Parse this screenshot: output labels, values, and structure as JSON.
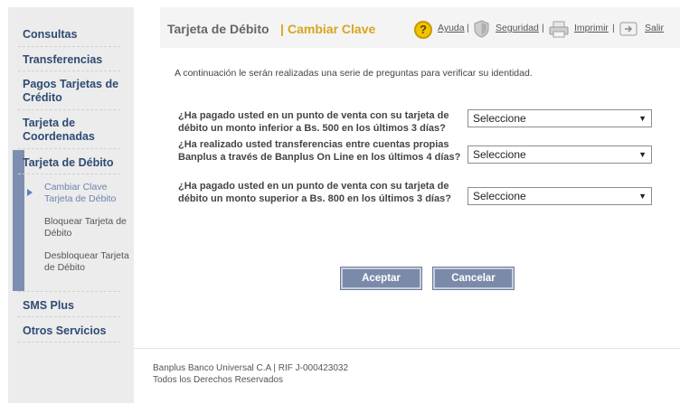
{
  "sidebar": {
    "items": [
      {
        "label": "Consultas"
      },
      {
        "label": "Transferencias"
      },
      {
        "label": "Pagos Tarjetas de Crédito"
      },
      {
        "label": "Tarjeta de Coordenadas"
      },
      {
        "label": "Tarjeta de Débito"
      },
      {
        "label": "SMS Plus"
      },
      {
        "label": "Otros Servicios"
      }
    ],
    "subitems": [
      {
        "label": "Cambiar Clave Tarjeta de Débito"
      },
      {
        "label": "Bloquear Tarjeta de Débito"
      },
      {
        "label": "Desbloquear Tarjeta de Débito"
      }
    ]
  },
  "header": {
    "title": "Tarjeta de Débito",
    "separator": "|",
    "subtitle": "Cambiar Clave",
    "help_glyph": "?",
    "links": {
      "ayuda": "Ayuda",
      "seguridad": "Seguridad",
      "imprimir": "Imprimir",
      "salir": "Salir",
      "pipe": "|"
    }
  },
  "form": {
    "intro": "A continuación le serán realizadas una serie de preguntas para verificar su identidad.",
    "questions": [
      {
        "text": "¿Ha pagado usted en un punto de venta con su tarjeta de débito un monto inferior a Bs. 500 en los últimos 3 días?",
        "selected": "Seleccione"
      },
      {
        "text": "¿Ha realizado usted transferencias entre cuentas propias Banplus a través de Banplus On Line en los últimos 4 días?",
        "selected": "Seleccione"
      },
      {
        "text": "¿Ha pagado usted en un punto de venta con su tarjeta de débito un monto superior a Bs. 800 en los últimos 3 días?",
        "selected": "Seleccione"
      }
    ],
    "accept_label": "Aceptar",
    "cancel_label": "Cancelar"
  },
  "footer": {
    "line1": "Banplus Banco Universal C.A | RIF J-000423032",
    "line2": "Todos los Derechos Reservados"
  },
  "icons": {
    "help": "help-icon",
    "security": "shield-icon",
    "print": "printer-icon",
    "exit": "exit-icon"
  },
  "colors": {
    "nav_text": "#2f4b73",
    "accent_gold": "#d7a51f",
    "button_bg": "#7b8aa9",
    "sidebar_accent": "#7c8fb0"
  }
}
